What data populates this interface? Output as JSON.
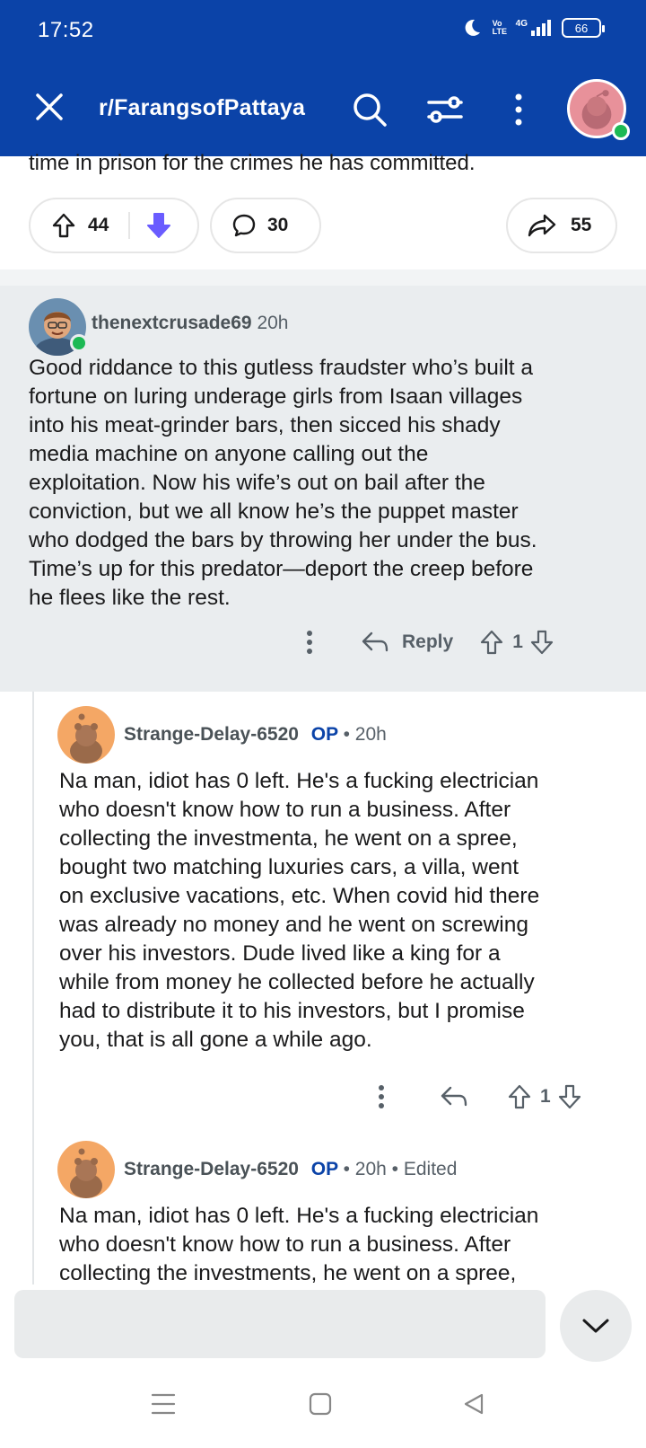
{
  "status_bar": {
    "time": "17:52",
    "network": "4G",
    "volte": "Vo LTE",
    "battery": "66"
  },
  "header": {
    "subreddit": "r/FarangsofPattaya"
  },
  "post": {
    "cut_text": "time in prison for the crimes he has committed.",
    "upvotes": "44",
    "comments": "30",
    "shares": "55"
  },
  "comments": [
    {
      "username": "thenextcrusade69",
      "time": "20h",
      "lines": [
        "Good riddance to this gutless fraudster who’s built a",
        "fortune on luring underage girls from Isaan villages",
        "into his meat-grinder bars, then sicced his shady",
        "media machine on anyone calling out the",
        "exploitation. Now his wife’s out on bail after the",
        "conviction, but we all know he’s the puppet master",
        "who dodged the bars by throwing her under the bus.",
        "Time’s up for this predator—deport the creep before",
        "he flees like the rest."
      ],
      "reply_label": "Reply",
      "score": "1"
    },
    {
      "username": "Strange-Delay-6520",
      "op_label": "OP",
      "time": "• 20h",
      "lines": [
        "Na man, idiot has 0 left. He's a fucking electrician",
        "who doesn't know how to run a business. After",
        "collecting the investmenta, he went on a spree,",
        "bought two matching luxuries cars, a villa, went",
        "on exclusive vacations, etc. When covid hid there",
        "was already no money and he went on screwing",
        "over his investors. Dude lived like a king for a",
        "while from money he collected before he actually",
        "had to distribute it to his investors, but I promise",
        "you, that is all gone a while ago."
      ],
      "score": "1"
    },
    {
      "username": "Strange-Delay-6520",
      "op_label": "OP",
      "time": "• 20h",
      "edited": "• Edited",
      "lines": [
        "Na man, idiot has 0 left. He's a fucking electrician",
        "who doesn't know how to run a business. After",
        "collecting the investments, he went on a spree,"
      ]
    }
  ],
  "colors": {
    "header_bg": "#0b43a8",
    "downvote_active": "#6a5cff",
    "online": "#1db954"
  }
}
